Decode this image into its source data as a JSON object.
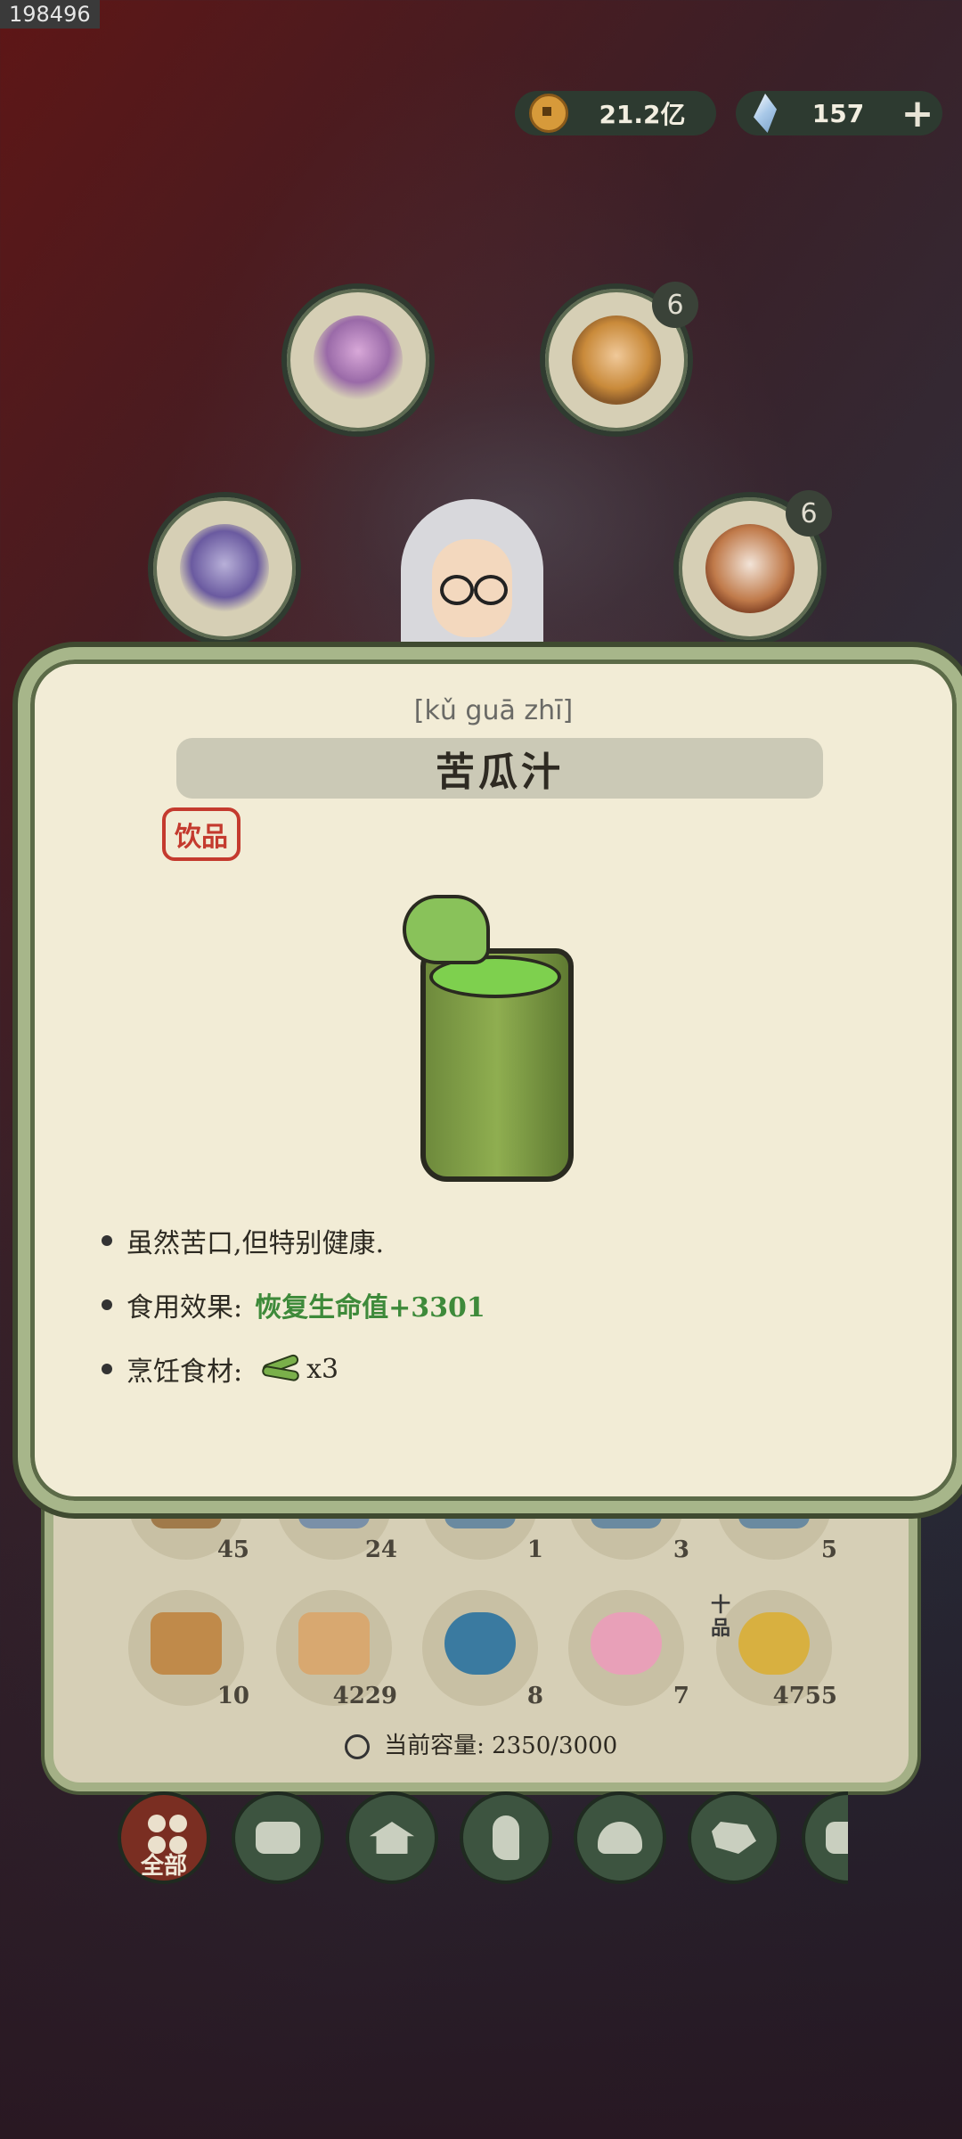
{
  "screen_id": "198496",
  "currency": {
    "coins": "21.2亿",
    "gems": "157",
    "add_label": "+"
  },
  "portraits": [
    {
      "name": "lotus-altar",
      "badge": ""
    },
    {
      "name": "hero-gold",
      "badge": "6"
    },
    {
      "name": "armor-purple",
      "badge": ""
    },
    {
      "name": "hero-white-hair",
      "badge": "6"
    }
  ],
  "item_detail": {
    "pinyin": "[kǔ guā zhī]",
    "title": "苦瓜汁",
    "category": "饮品",
    "description": "虽然苦口,但特别健康.",
    "effect_label": "食用效果:",
    "effect_value": "恢复生命值+3301",
    "ingredients_label": "烹饪食材:",
    "ingredients_count": "x3"
  },
  "inventory": {
    "row1": [
      "45",
      "24",
      "1",
      "3",
      "5"
    ],
    "row2": [
      "10",
      "4229",
      "8",
      "7",
      "4755"
    ],
    "quality_tag": "十品",
    "capacity_label": "当前容量:",
    "capacity_value": "2350/3000"
  },
  "tabs": {
    "all_label": "全部"
  },
  "colors": {
    "panel_bg": "#f2ecd6",
    "panel_border": "#a7b68a",
    "effect_green": "#3e8a3a",
    "stamp_red": "#c43a2e",
    "tab_active": "#7a2e22",
    "tab_bg": "#3d5440"
  }
}
